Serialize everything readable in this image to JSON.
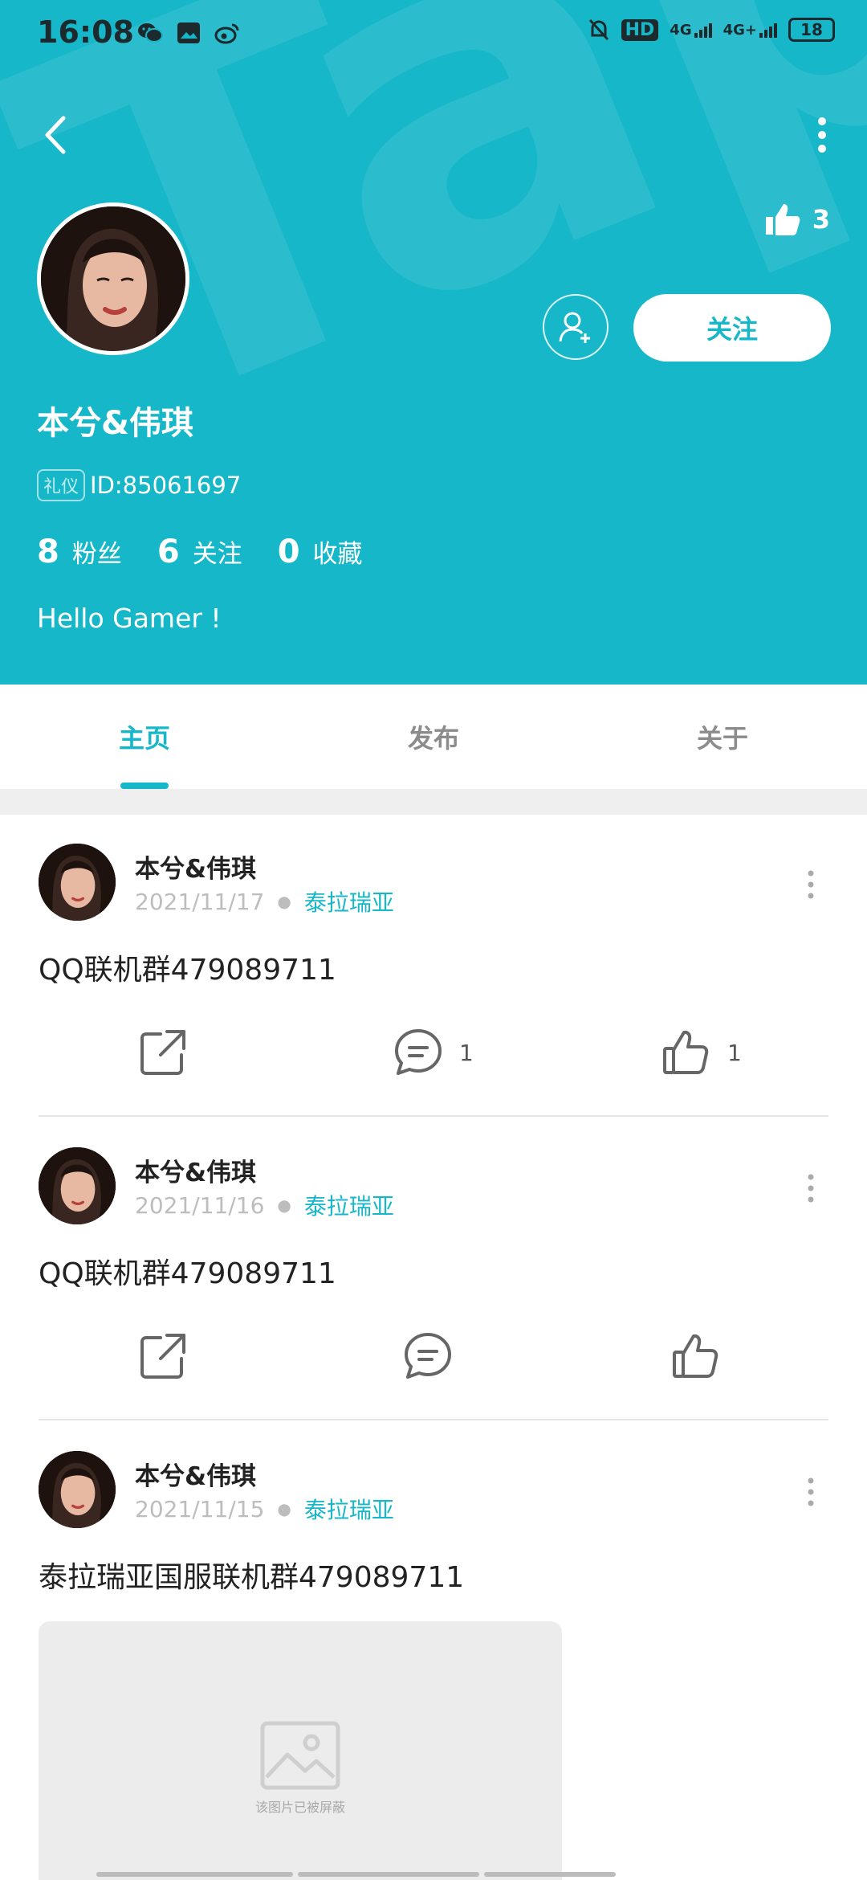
{
  "status_bar": {
    "time": "16:08",
    "app_icons": [
      "wechat-icon",
      "image-icon",
      "weibo-icon"
    ],
    "hd_label": "HD",
    "net1": "4G",
    "net2": "4G+",
    "battery": "18"
  },
  "header": {
    "background_color": "#16b7c8",
    "like_count": "3",
    "follow_label": "关注"
  },
  "profile": {
    "username": "本兮&伟琪",
    "badge": "礼仪",
    "id_text": "ID:85061697",
    "stats": [
      {
        "num": "8",
        "label": "粉丝"
      },
      {
        "num": "6",
        "label": "关注"
      },
      {
        "num": "0",
        "label": "收藏"
      }
    ],
    "bio": "Hello Gamer !"
  },
  "tabs": [
    {
      "label": "主页",
      "active": true
    },
    {
      "label": "发布",
      "active": false
    },
    {
      "label": "关于",
      "active": false
    }
  ],
  "posts": [
    {
      "author": "本兮&伟琪",
      "date": "2021/11/17",
      "tag": "泰拉瑞亚",
      "text": "QQ联机群479089711",
      "comments": "1",
      "likes": "1"
    },
    {
      "author": "本兮&伟琪",
      "date": "2021/11/16",
      "tag": "泰拉瑞亚",
      "text": "QQ联机群479089711",
      "comments": "",
      "likes": ""
    },
    {
      "author": "本兮&伟琪",
      "date": "2021/11/15",
      "tag": "泰拉瑞亚",
      "text": "泰拉瑞亚国服联机群479089711",
      "image_placeholder_text": "该图片已被屏蔽"
    }
  ]
}
